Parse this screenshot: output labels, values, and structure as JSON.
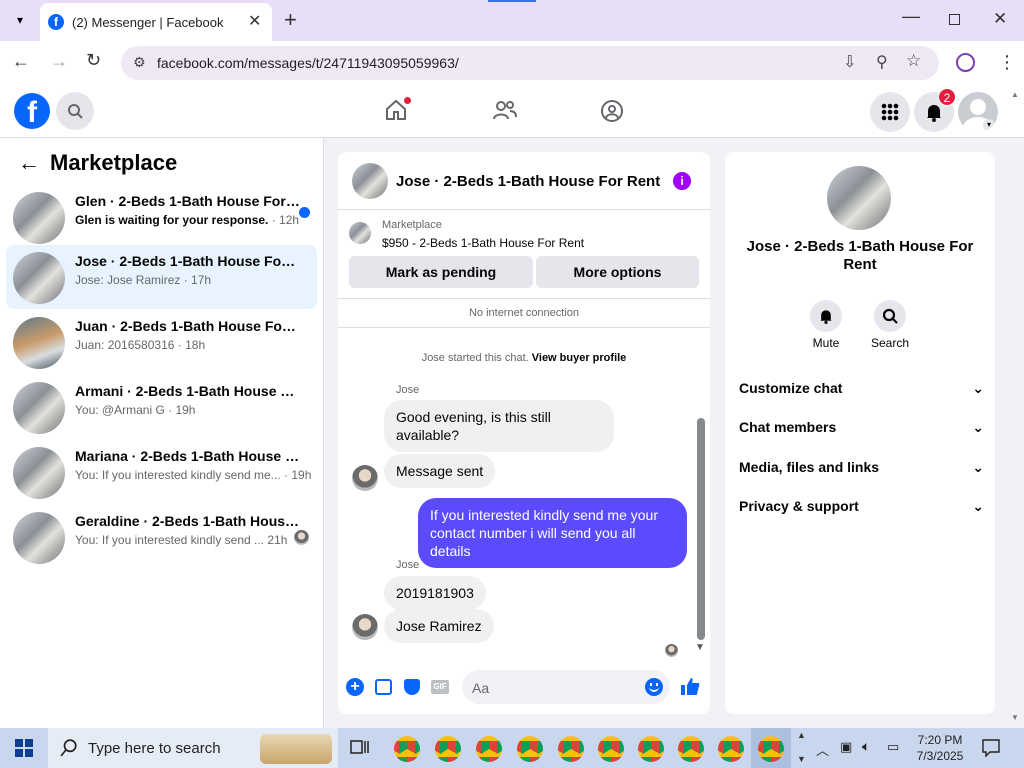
{
  "browser": {
    "tab_title": "(2) Messenger | Facebook",
    "url": "facebook.com/messages/t/24711943095059963/"
  },
  "header": {
    "notif_badge": "2"
  },
  "left": {
    "title": "Marketplace",
    "conversations": [
      {
        "title": "Glen · 2-Beds 1-Bath House For R...",
        "preview": "Glen is waiting for your response.",
        "time": "· 12h",
        "unread": true
      },
      {
        "title": "Jose · 2-Beds 1-Bath House For Rent",
        "preview": "Jose: Jose Ramirez",
        "time": "· 17h"
      },
      {
        "title": "Juan · 2-Beds 1-Bath House For Rent",
        "preview": "Juan: 2016580316",
        "time": "· 18h"
      },
      {
        "title": "Armani · 2-Beds 1-Bath House For ...",
        "preview": "You: @Armani G",
        "time": "· 19h"
      },
      {
        "title": "Mariana · 2-Beds 1-Bath House For...",
        "preview": "You: If you interested kindly send me...",
        "time": "· 19h"
      },
      {
        "title": "Geraldine · 2-Beds 1-Bath House...",
        "preview": "You: If you interested kindly send ...",
        "time": "21h"
      }
    ]
  },
  "chat": {
    "title": "Jose · 2-Beds 1-Bath House For Rent",
    "listing_source": "Marketplace",
    "listing": "$950 - 2-Beds 1-Bath House For Rent",
    "mark_pending": "Mark as pending",
    "more_options": "More options",
    "connection_notice": "No internet connection",
    "started_text": "Jose started this chat.",
    "view_profile": "View buyer profile",
    "messages": [
      {
        "sender": "Jose",
        "text": "Good evening, is this still available?"
      },
      {
        "text": "Message sent"
      },
      {
        "text": "If you interested kindly send me your contact number i will send you all details"
      },
      {
        "sender": "Jose",
        "text": "2019181903"
      },
      {
        "text": "Jose Ramirez"
      }
    ],
    "composer_placeholder": "Aa"
  },
  "right": {
    "name": "Jose · 2-Beds 1-Bath House For Rent",
    "mute": "Mute",
    "search": "Search",
    "sections": [
      "Customize chat",
      "Chat members",
      "Media, files and links",
      "Privacy & support"
    ]
  },
  "taskbar": {
    "search_placeholder": "Type here to search",
    "time": "7:20 PM",
    "date": "7/3/2025"
  },
  "colors": {
    "accent": "#0866ff",
    "my_bubble": "#5a4bff",
    "info_icon": "#a100ff"
  }
}
